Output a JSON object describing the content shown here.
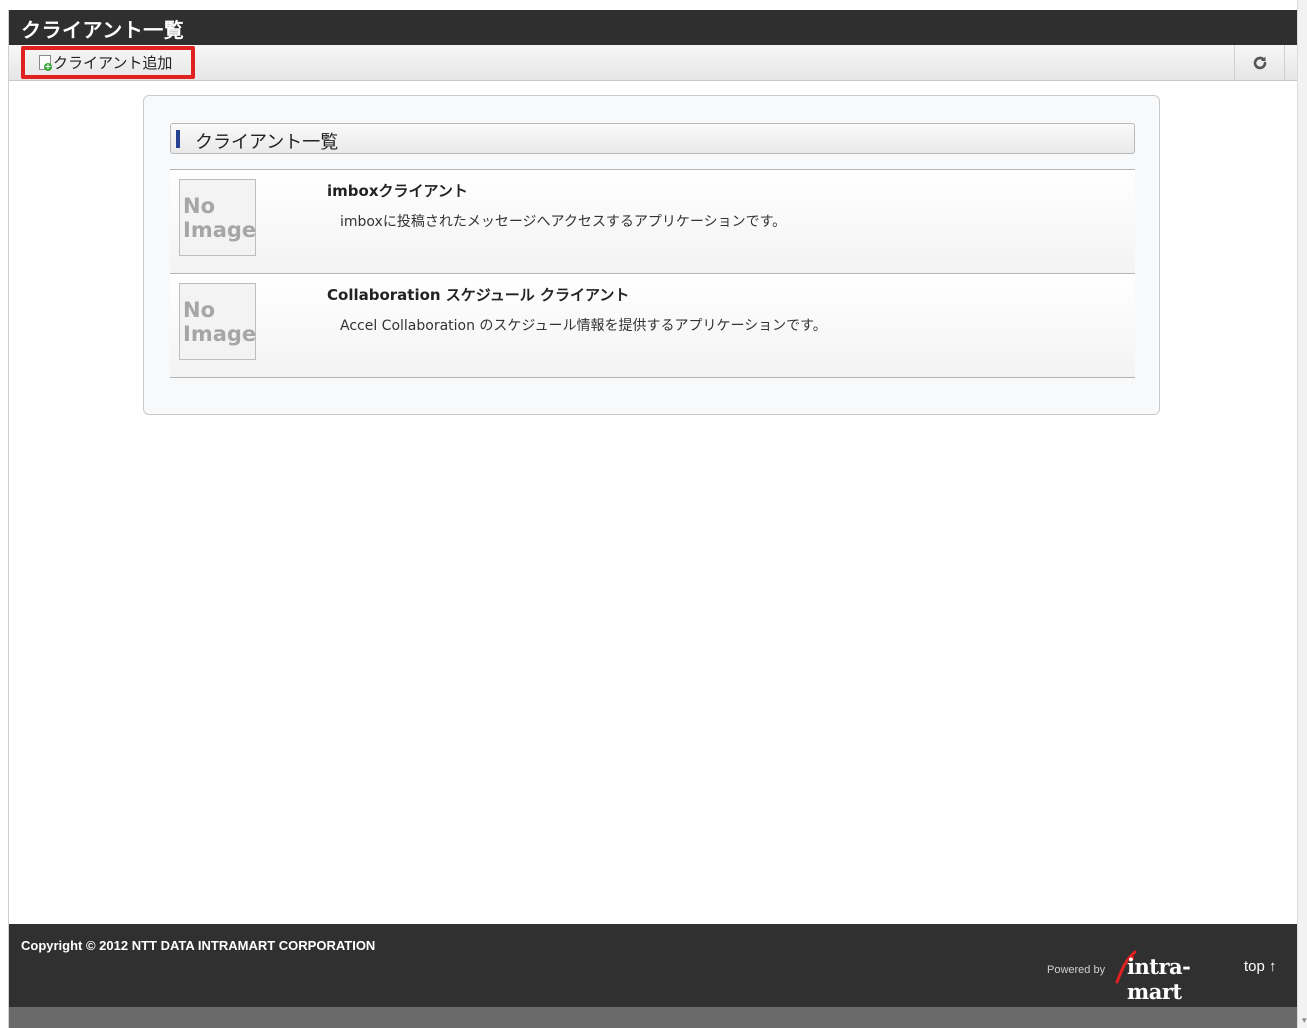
{
  "header": {
    "title": "クライアント一覧"
  },
  "toolbar": {
    "add_label": "クライアント追加",
    "refresh_icon": "refresh-icon"
  },
  "panel": {
    "section_title": "クライアント一覧",
    "clients": [
      {
        "thumbnail_text": [
          "No",
          "Image"
        ],
        "name": "imboxクライアント",
        "description": "imboxに投稿されたメッセージへアクセスするアプリケーションです。"
      },
      {
        "thumbnail_text": [
          "No",
          "Image"
        ],
        "name": "Collaboration スケジュール クライアント",
        "description": "Accel Collaboration のスケジュール情報を提供するアプリケーションです。"
      }
    ]
  },
  "footer": {
    "copyright": "Copyright © 2012 NTT DATA INTRAMART CORPORATION",
    "powered_by": "Powered by",
    "brand": "intra-mart",
    "top_link": "top ↑"
  },
  "colors": {
    "highlight_border": "#e0211f",
    "title_bar": "#2f2f2f",
    "section_accent": "#24428f"
  }
}
